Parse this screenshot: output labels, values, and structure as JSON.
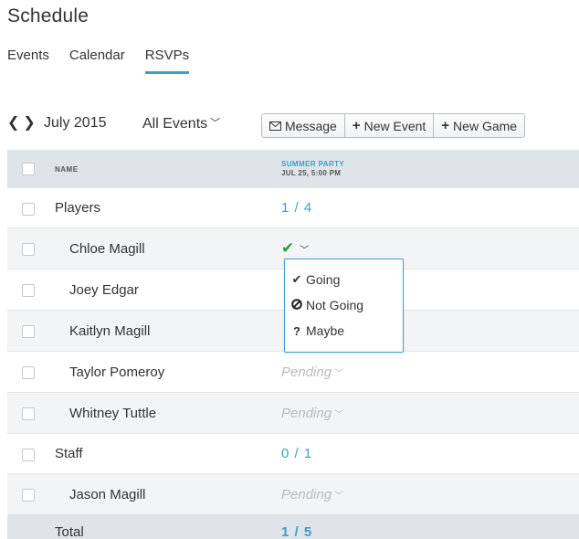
{
  "page": {
    "title": "Schedule"
  },
  "tabs": [
    {
      "label": "Events"
    },
    {
      "label": "Calendar"
    },
    {
      "label": "RSVPs",
      "active": true
    }
  ],
  "toolbar": {
    "prev_icon": "‹",
    "next_icon": "›",
    "month": "July 2015",
    "filter_label": "All Events",
    "message_label": "Message",
    "new_event_label": "New Event",
    "new_game_label": "New Game"
  },
  "table": {
    "name_header": "NAME",
    "event_title": "SUMMER PARTY",
    "event_date": "JUL 25, 5:00 PM",
    "rows": [
      {
        "type": "group",
        "name": "Players",
        "rsvp": "1 / 4"
      },
      {
        "type": "member",
        "name": "Chloe Magill",
        "rsvp": "going"
      },
      {
        "type": "member",
        "name": "Joey Edgar",
        "rsvp": ""
      },
      {
        "type": "member",
        "name": "Kaitlyn Magill",
        "rsvp": ""
      },
      {
        "type": "member",
        "name": "Taylor Pomeroy",
        "rsvp": "Pending"
      },
      {
        "type": "member",
        "name": "Whitney Tuttle",
        "rsvp": "Pending"
      },
      {
        "type": "group",
        "name": "Staff",
        "rsvp": "0 / 1"
      },
      {
        "type": "member",
        "name": "Jason Magill",
        "rsvp": "Pending"
      }
    ],
    "total_label": "Total",
    "total_value": "1 / 5"
  },
  "rsvp_menu": {
    "options": [
      {
        "icon": "check-icon",
        "label": "Going"
      },
      {
        "icon": "not-allowed-icon",
        "label": "Not Going"
      },
      {
        "icon": "question-icon",
        "label": "Maybe"
      }
    ]
  },
  "colors": {
    "accent": "#3aa0c8",
    "going": "#2d9a3a",
    "header_bg": "#dfe4e8",
    "pending": "#b7bbbf"
  }
}
